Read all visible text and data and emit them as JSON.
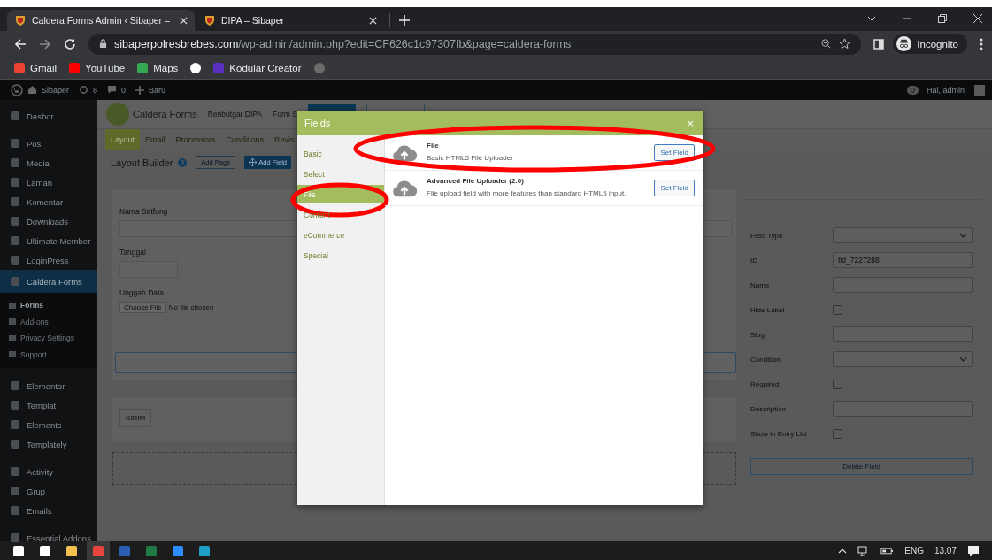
{
  "browser": {
    "tabs": [
      {
        "title": "Caldera Forms Admin ‹ Sibaper –",
        "selected": true
      },
      {
        "title": "DIPA – Sibaper",
        "selected": false
      }
    ],
    "url": {
      "host": "sibaperpolresbrebes.com",
      "path": "/wp-admin/admin.php?edit=CF626c1c97307fb&page=caldera-forms"
    },
    "profile": "Incognito",
    "bookmarks": [
      {
        "kind": "gmail",
        "label": "Gmail"
      },
      {
        "kind": "youtube",
        "label": "YouTube"
      },
      {
        "kind": "maps",
        "label": "Maps"
      },
      {
        "kind": "google"
      },
      {
        "kind": "kodular",
        "label": "Kodular Creator"
      },
      {
        "kind": "globe"
      }
    ]
  },
  "admin_bar": {
    "site": "Sibaper",
    "updates": "8",
    "comments": "0",
    "new": "Baru",
    "notifications": "0",
    "greeting": "Hai, admin"
  },
  "sidebar": {
    "groups": [
      [
        {
          "label": "Dasbor",
          "selected": false
        }
      ],
      [
        {
          "label": "Pos",
          "selected": false
        },
        {
          "label": "Media",
          "selected": false
        },
        {
          "label": "Laman",
          "selected": false
        },
        {
          "label": "Komentar",
          "selected": false
        },
        {
          "label": "Downloads",
          "selected": false
        },
        {
          "label": "Ultimate Member",
          "selected": false
        },
        {
          "label": "LoginPress",
          "selected": false
        },
        {
          "label": "Caldera Forms",
          "selected": true,
          "children": [
            {
              "label": "Forms",
              "selected": true
            },
            {
              "label": "Add-ons",
              "selected": false
            },
            {
              "label": "Privacy Settings",
              "selected": false
            },
            {
              "label": "Support",
              "selected": false
            }
          ]
        }
      ],
      [
        {
          "label": "Elementor",
          "selected": false
        },
        {
          "label": "Templat",
          "selected": false
        },
        {
          "label": "Elements",
          "selected": false
        },
        {
          "label": "Templately",
          "selected": false
        }
      ],
      [
        {
          "label": "Activity",
          "selected": false
        },
        {
          "label": "Grup",
          "selected": false
        },
        {
          "label": "Emails",
          "selected": false
        }
      ],
      [
        {
          "label": "Essential Addons",
          "selected": false
        }
      ]
    ]
  },
  "editor": {
    "brand": "Caldera Forms",
    "form_name": "Renbutgar DIPA",
    "form_tab": "Form S",
    "tabs": [
      {
        "label": "Layout",
        "selected": true
      },
      {
        "label": "Email",
        "selected": false
      },
      {
        "label": "Processors",
        "selected": false
      },
      {
        "label": "Conditions",
        "selected": false
      },
      {
        "label": "Revis",
        "selected": false
      }
    ],
    "layout_title": "Layout Builder",
    "add_page": "Add Page",
    "add_field": "Add Field",
    "form_fields": [
      {
        "kind": "text",
        "label": "Nama Satfung"
      },
      {
        "kind": "short",
        "label": "Tanggal"
      },
      {
        "kind": "file",
        "label": "Unggah Data",
        "button": "Choose File",
        "status": "No file chosen"
      }
    ],
    "submit": "KIRIM",
    "settings": [
      {
        "kind": "select",
        "label": "Field Type"
      },
      {
        "kind": "text",
        "label": "ID",
        "value": "fld_7227288"
      },
      {
        "kind": "text",
        "label": "Name"
      },
      {
        "kind": "checkbox",
        "label": "Hide Label",
        "checked": false
      },
      {
        "kind": "text",
        "label": "Slug"
      },
      {
        "kind": "select",
        "label": "Condition"
      },
      {
        "kind": "checkbox",
        "label": "Required",
        "checked": false
      },
      {
        "kind": "text",
        "label": "Description"
      },
      {
        "kind": "checkbox",
        "label": "Show in Entry List",
        "checked": false
      }
    ],
    "delete": "Delete Field"
  },
  "modal": {
    "title": "Fields",
    "close": "×",
    "categories": [
      {
        "label": "Basic",
        "selected": false,
        "circled": false
      },
      {
        "label": "Select",
        "selected": false,
        "circled": false
      },
      {
        "label": "File",
        "selected": true,
        "circled": true
      },
      {
        "label": "Content",
        "selected": false,
        "circled": false
      },
      {
        "label": "eCommerce",
        "selected": false,
        "circled": false
      },
      {
        "label": "Special",
        "selected": false,
        "circled": false
      }
    ],
    "fields": [
      {
        "name": "File",
        "description": "Basic HTML5 File Uploader",
        "button": "Set Field",
        "circled": true
      },
      {
        "name": "Advanced File Uploader (2.0)",
        "description": "File upload field with more features than standard HTML5 input.",
        "button": "Set Field",
        "circled": false
      }
    ]
  },
  "taskbar": {
    "apps": [
      {
        "kind": "start",
        "selected": false
      },
      {
        "kind": "taskview",
        "selected": false
      },
      {
        "kind": "explorer",
        "selected": false
      },
      {
        "kind": "chrome",
        "selected": true
      },
      {
        "kind": "word",
        "selected": false
      },
      {
        "kind": "excel",
        "selected": false
      },
      {
        "kind": "zoom",
        "selected": false
      },
      {
        "kind": "edge",
        "selected": false
      }
    ],
    "language": "ENG",
    "time": "13.07"
  }
}
